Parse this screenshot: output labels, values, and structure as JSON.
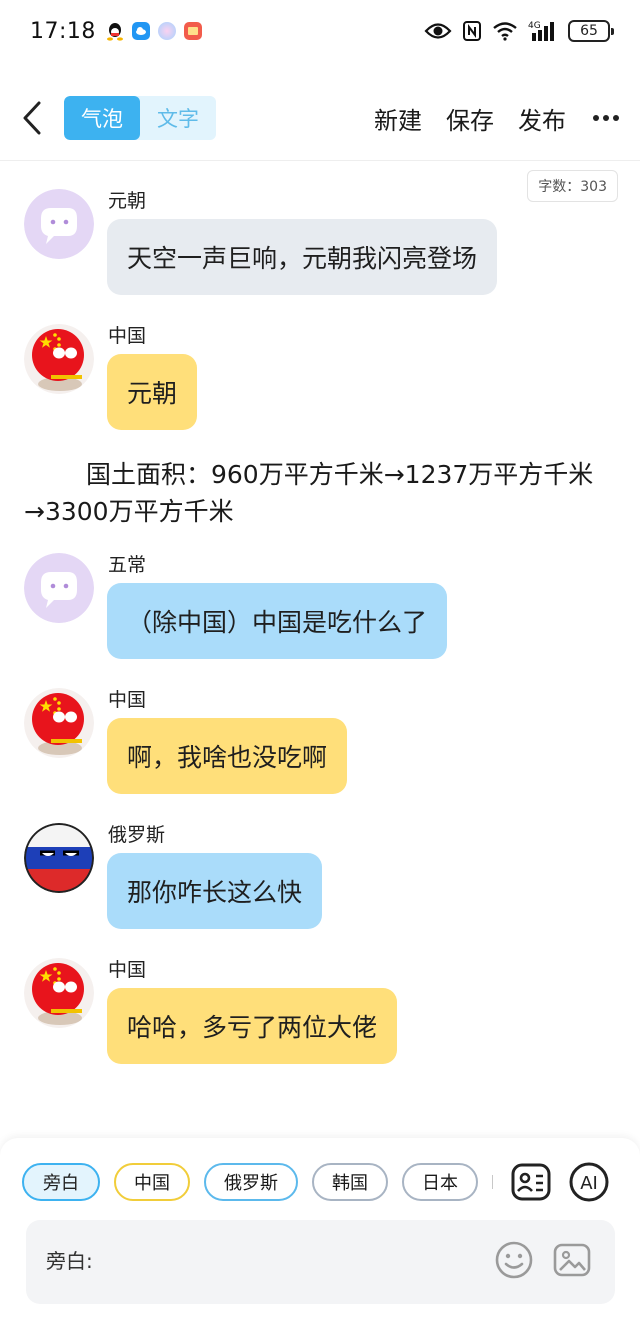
{
  "status_bar": {
    "time": "17:18",
    "network": "4G",
    "battery": "65"
  },
  "header": {
    "tabs": [
      {
        "label": "气泡",
        "active": true
      },
      {
        "label": "文字",
        "active": false
      }
    ],
    "actions": {
      "new": "新建",
      "save": "保存",
      "publish": "发布"
    }
  },
  "word_count": "字数：303",
  "messages": [
    {
      "speaker": "元朝",
      "text": "天空一声巨响，元朝我闪亮登场",
      "bubble_color": "#e7ebf0",
      "avatar": "default-purple"
    },
    {
      "speaker": "中国",
      "text": "元朝",
      "bubble_color": "#ffdf7a",
      "avatar": "china-ball"
    },
    {
      "speaker": "五常",
      "text": "（除中国）中国是吃什么了",
      "bubble_color": "#aadcfa",
      "avatar": "default-purple"
    },
    {
      "speaker": "中国",
      "text": "啊，我啥也没吃啊",
      "bubble_color": "#ffdf7a",
      "avatar": "china-ball"
    },
    {
      "speaker": "俄罗斯",
      "text": "那你咋长这么快",
      "bubble_color": "#aadcfa",
      "avatar": "russia-ball"
    },
    {
      "speaker": "中国",
      "text": "哈哈，多亏了两位大佬",
      "bubble_color": "#ffdf7a",
      "avatar": "china-ball"
    }
  ],
  "narration": "国土面积：960万平方千米→1237万平方千米→3300万平方千米",
  "bottom_bar": {
    "chips": [
      "旁白",
      "中国",
      "俄罗斯",
      "韩国",
      "日本"
    ],
    "ai_label": "AI",
    "input_placeholder": "旁白:"
  },
  "colors": {
    "accent": "#3db2f0",
    "yellow_bubble": "#ffdf7a",
    "blue_bubble": "#aadcfa",
    "gray_bubble": "#e7ebf0"
  }
}
